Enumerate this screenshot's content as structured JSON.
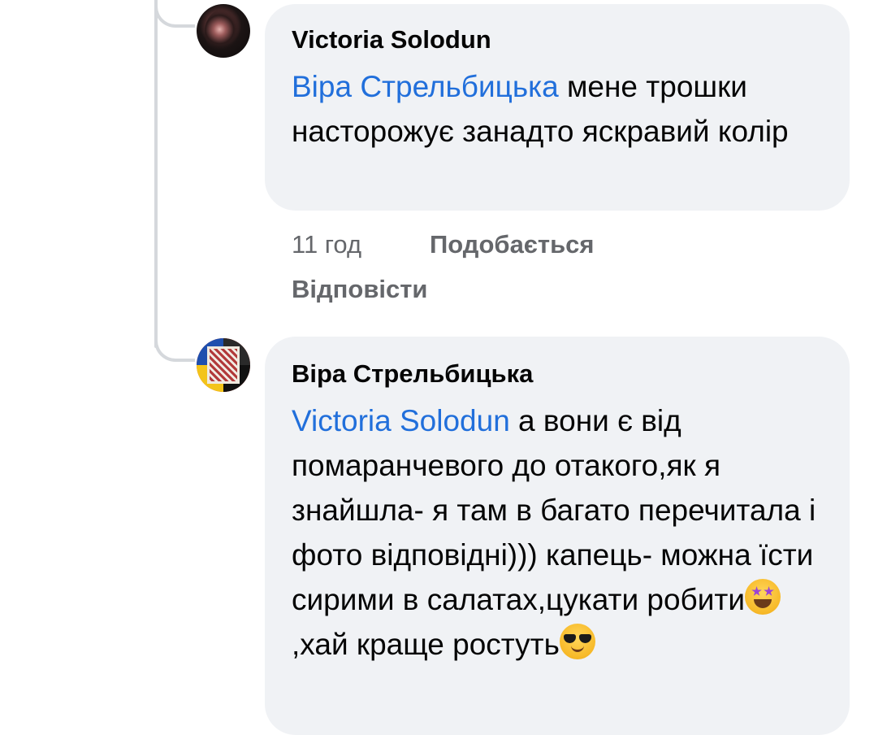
{
  "comments": [
    {
      "author": "Victoria Solodun",
      "mention": "Віра Стрельбицька",
      "text": " мене трошки насторожує занадто яскравий колір",
      "time": "11 год",
      "like_label": "Подобається",
      "reply_label": "Відповісти"
    },
    {
      "author": "Віра Стрельбицька",
      "mention": "Victoria Solodun",
      "text_part1": " а вони є від помаранчевого до отакого,як я знайшла- я там в багато перечитала і фото відповідні))) капець- можна їсти сирими в салатах,цукати робити",
      "emoji1": "star-struck-emoji",
      "text_part2": ",хай краще ростуть",
      "emoji2": "sunglasses-emoji"
    }
  ],
  "colors": {
    "mention": "#216fdb",
    "bubble": "#f0f2f5",
    "meta": "#65676b"
  }
}
